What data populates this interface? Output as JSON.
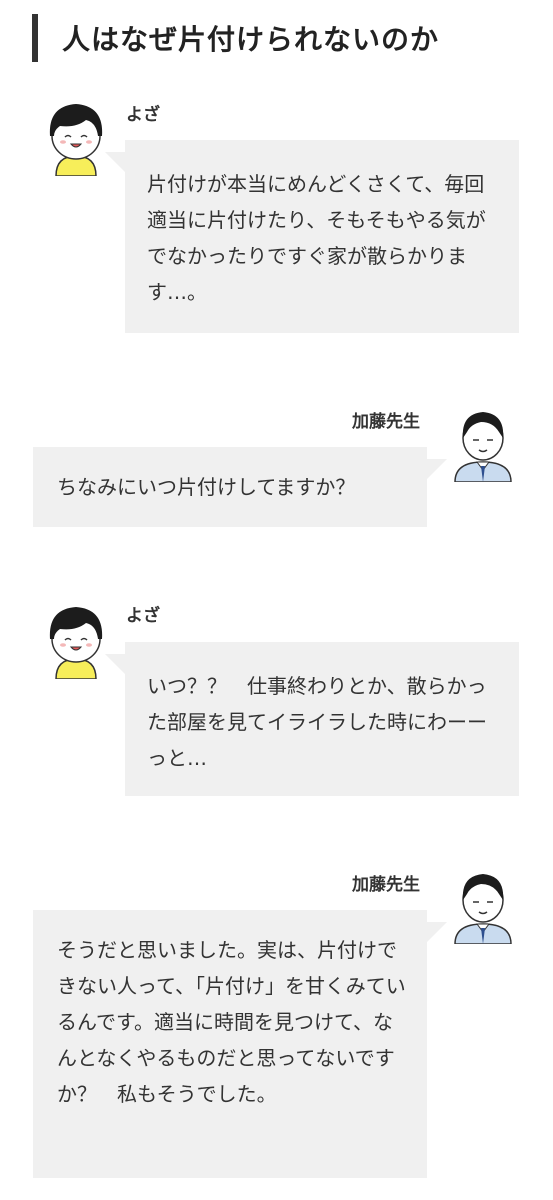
{
  "heading": "人はなぜ片付けられないのか",
  "messages": [
    {
      "speaker": "よざ",
      "text": "片付けが本当にめんどくさくて、毎回適当に片付けたり、そもそもやる気がでなかったりですぐ家が散らかります…。"
    },
    {
      "speaker": "加藤先生",
      "text": "ちなみにいつ片付けしてますか？"
    },
    {
      "speaker": "よざ",
      "text": "いつ？？　仕事終わりとか、散らかった部屋を見てイライラした時にわーーっと…"
    },
    {
      "speaker": "加藤先生",
      "text": "そうだと思いました。実は、片付けできない人って、「片付け」を甘くみているんです。適当に時間を見つけて、なんとなくやるものだと思ってないですか？　私もそうでした。"
    }
  ],
  "colors": {
    "bubble_bg": "#f0f0f0",
    "text": "#333333",
    "avatar_face": "#ffffff",
    "yoza_hair": "#1c1c1c",
    "yoza_shirt": "#f7ee5a",
    "teacher_shirt": "#c9dbef",
    "teacher_tie": "#2e4f8f"
  },
  "icons": {
    "yoza": "girl-bob-haircut-avatar",
    "teacher": "man-suit-avatar"
  }
}
